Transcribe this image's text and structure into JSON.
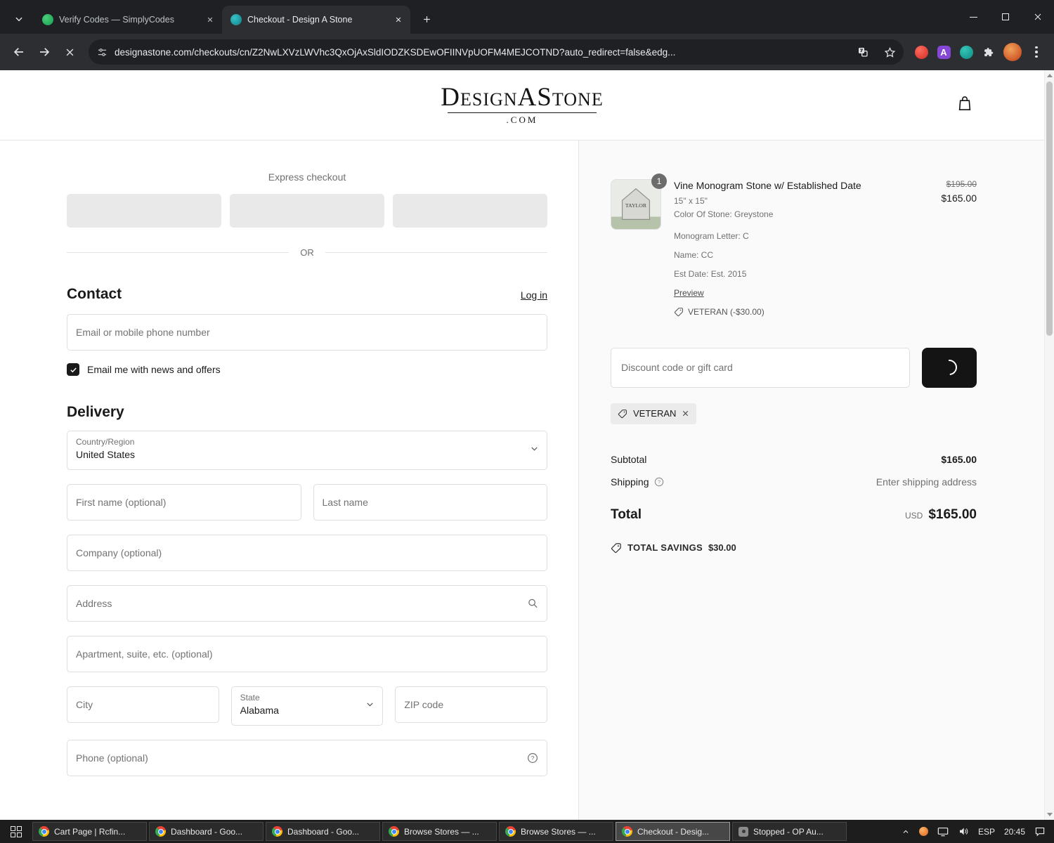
{
  "browser": {
    "tabs": [
      "Verify Codes — SimplyCodes",
      "Checkout - Design A Stone"
    ],
    "url": "designastone.com/checkouts/cn/Z2NwLXVzLWVhc3QxOjAxSldIODZKSDEwOFIINVpUOFM4MEJCOTND?auto_redirect=false&edg..."
  },
  "glyphs": {
    "a": "A",
    "question": "?"
  },
  "header": {
    "logo_main": "DesignAStone",
    "logo_sub": ".COM"
  },
  "checkout": {
    "express_label": "Express checkout",
    "or_label": "OR",
    "contact": {
      "title": "Contact",
      "login": "Log in",
      "email_placeholder": "Email or mobile phone number",
      "newsletter": "Email me with news and offers"
    },
    "delivery": {
      "title": "Delivery",
      "country_label": "Country/Region",
      "country_value": "United States",
      "first_name": "First name (optional)",
      "last_name": "Last name",
      "company": "Company (optional)",
      "address": "Address",
      "apartment": "Apartment, suite, etc. (optional)",
      "city": "City",
      "state_label": "State",
      "state_value": "Alabama",
      "zip": "ZIP code",
      "phone": "Phone (optional)"
    }
  },
  "summary": {
    "item": {
      "quantity": "1",
      "title": "Vine Monogram Stone w/ Established Date",
      "size": "15\" x 15\"",
      "color": "Color Of Stone: Greystone",
      "monogram": "Monogram Letter: C",
      "name": "Name: CC",
      "est_date": "Est Date: Est. 2015",
      "preview": "Preview",
      "discount_note": "VETERAN (-$30.00)",
      "price_original": "$195.00",
      "price_current": "$165.00",
      "thumb_text": "TAYLOR"
    },
    "discount_placeholder": "Discount code or gift card",
    "applied_code": "VETERAN",
    "subtotal_label": "Subtotal",
    "subtotal_value": "$165.00",
    "shipping_label": "Shipping",
    "shipping_value": "Enter shipping address",
    "total_label": "Total",
    "currency": "USD",
    "total_value": "$165.00",
    "savings_label": "TOTAL SAVINGS",
    "savings_value": "$30.00"
  },
  "taskbar": {
    "items": [
      "Cart Page | Rcfin...",
      "Dashboard - Goo...",
      "Dashboard - Goo...",
      "Browse Stores — ...",
      "Browse Stores — ...",
      "Checkout - Desig...",
      "Stopped - OP Au..."
    ],
    "lang": "ESP",
    "time": "20:45"
  }
}
